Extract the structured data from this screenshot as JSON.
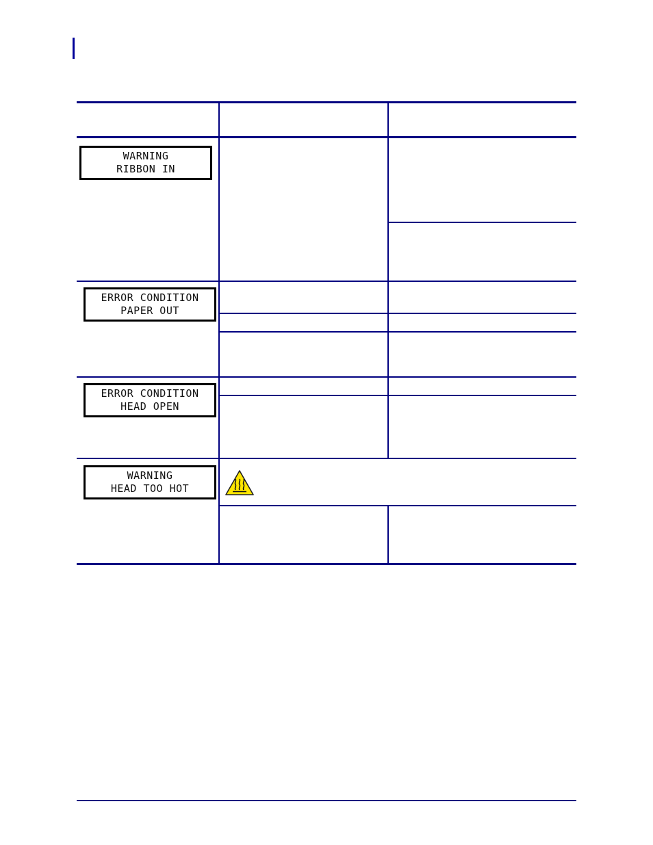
{
  "page": {
    "change_bar": true
  },
  "table": {
    "columns": [
      "",
      "",
      ""
    ],
    "rows": [
      {
        "lcd": {
          "line1": "WARNING",
          "line2": "RIBBON IN"
        },
        "subrows": 2
      },
      {
        "lcd": {
          "line1": "ERROR CONDITION",
          "line2": "PAPER OUT"
        },
        "subrows": 3
      },
      {
        "lcd": {
          "line1": "ERROR CONDITION",
          "line2": "HEAD OPEN"
        },
        "subrows": 2
      },
      {
        "lcd": {
          "line1": "WARNING",
          "line2": "HEAD TOO HOT"
        },
        "icon": "hot-surface-warning-icon",
        "subrows": 2
      }
    ]
  },
  "colors": {
    "rule": "#000080",
    "warning_yellow": "#FFE600"
  }
}
